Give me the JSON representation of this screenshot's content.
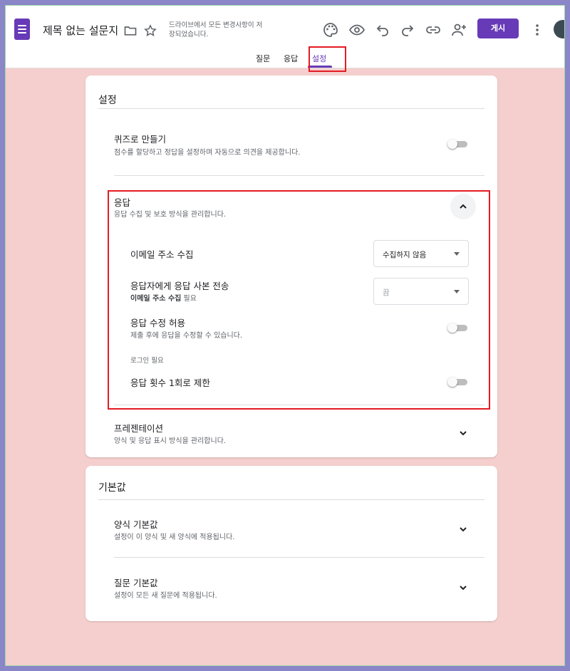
{
  "header": {
    "title": "제목 없는 설문지",
    "save_status": "드라이브에서 모든 변경사항이 저장되었습니다.",
    "publish_label": "게시",
    "icons": [
      "folder-icon",
      "star-icon",
      "palette-icon",
      "preview-eye-icon",
      "undo-icon",
      "redo-icon",
      "link-icon",
      "add-collaborator-icon",
      "more-vert-icon"
    ]
  },
  "tabs": [
    {
      "label": "질문",
      "active": false
    },
    {
      "label": "응답",
      "active": false
    },
    {
      "label": "설정",
      "active": true
    }
  ],
  "settings": {
    "heading": "설정",
    "quiz": {
      "title": "퀴즈로 만들기",
      "subtitle": "점수를 할당하고 정답을 설정하며 자동으로 의견을 제공합니다.",
      "enabled": false
    },
    "responses": {
      "title": "응답",
      "subtitle": "응답 수집 및 보호 방식을 관리합니다.",
      "expanded": true,
      "collect_email": {
        "label": "이메일 주소 수집",
        "value": "수집하지 않음"
      },
      "send_copy": {
        "label": "응답자에게 응답 사본 전송",
        "note_bold": "이메일 주소 수집",
        "note_rest": " 필요",
        "value": "끔"
      },
      "allow_edit": {
        "label": "응답 수정 허용",
        "subtitle": "제출 후에 응답을 수정할 수 있습니다.",
        "enabled": false
      },
      "login_required_heading": "로그인 필요",
      "limit_one": {
        "label": "응답 횟수 1회로 제한",
        "enabled": false
      }
    },
    "presentation": {
      "title": "프레젠테이션",
      "subtitle": "양식 및 응답 표시 방식을 관리합니다."
    }
  },
  "defaults": {
    "heading": "기본값",
    "form_defaults": {
      "title": "양식 기본값",
      "subtitle": "설정이 이 양식 및 새 양식에 적용됩니다."
    },
    "question_defaults": {
      "title": "질문 기본값",
      "subtitle": "설정이 모든 새 질문에 적용됩니다."
    }
  },
  "colors": {
    "brand": "#673ab7",
    "background": "#f4cfcd",
    "highlight": "#e31b23"
  }
}
